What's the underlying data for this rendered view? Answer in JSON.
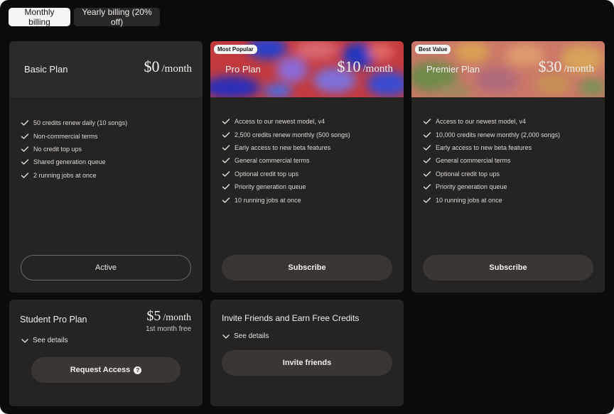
{
  "billing_toggle": {
    "monthly_label": "Monthly billing",
    "yearly_label": "Yearly billing (20% off)",
    "selected": "monthly"
  },
  "plans": [
    {
      "name": "Basic Plan",
      "price": "$0",
      "period": "/month",
      "badge": "",
      "features": [
        "50 credits renew daily (10 songs)",
        "Non-commercial terms",
        "No credit top ups",
        "Shared generation queue",
        "2 running jobs at once"
      ],
      "cta": "Active"
    },
    {
      "name": "Pro Plan",
      "price": "$10",
      "period": "/month",
      "badge": "Most Popular",
      "features": [
        "Access to our newest model, v4",
        "2,500 credits renew monthly (500 songs)",
        "Early access to new beta features",
        "General commercial terms",
        "Optional credit top ups",
        "Priority generation queue",
        "10 running jobs at once"
      ],
      "cta": "Subscribe"
    },
    {
      "name": "Premier Plan",
      "price": "$30",
      "period": "/month",
      "badge": "Best Value",
      "features": [
        "Access to our newest model, v4",
        "10,000 credits renew monthly (2,000 songs)",
        "Early access to new beta features",
        "General commercial terms",
        "Optional credit top ups",
        "Priority generation queue",
        "10 running jobs at once"
      ],
      "cta": "Subscribe"
    }
  ],
  "student": {
    "name": "Student Pro Plan",
    "price": "$5",
    "period": "/month",
    "note": "1st month free",
    "details": "See details",
    "cta": "Request Access",
    "help_icon": "?"
  },
  "invite": {
    "title": "Invite Friends and Earn Free Credits",
    "details": "See details",
    "cta": "Invite friends"
  },
  "colors": {
    "background": "#0c0b0b",
    "card": "#262423",
    "card_header": "#2d2b2a",
    "button_filled": "#393634",
    "text": "#e8e6e3"
  },
  "icons": {
    "feature": "check-icon",
    "details": "chevron-down-icon",
    "help": "question-circle-icon"
  }
}
